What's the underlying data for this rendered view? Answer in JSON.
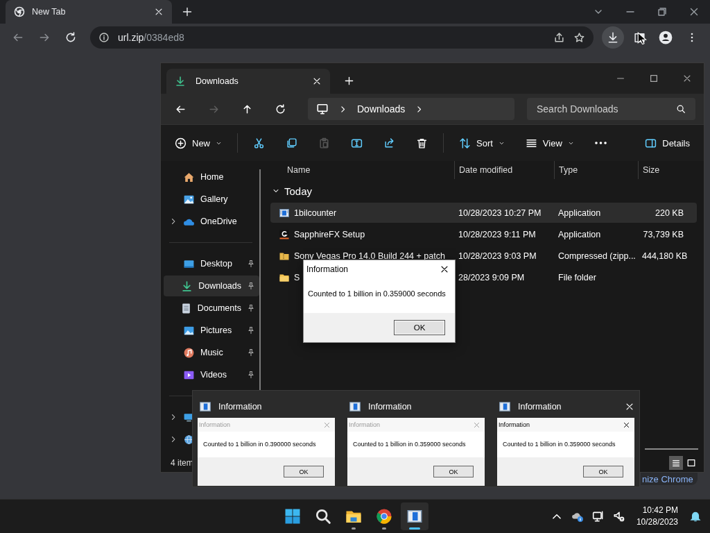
{
  "browser": {
    "tabs": [
      {
        "title": "New Tab",
        "selected": true
      }
    ],
    "address": {
      "host": "url.zip",
      "path": "/0384ed8"
    },
    "download_button": {
      "highlighted": true
    }
  },
  "explorer": {
    "tab_title": "Downloads",
    "breadcrumb": [
      "Downloads"
    ],
    "search": {
      "placeholder": "Search Downloads"
    },
    "nav": [
      {
        "kind": "back",
        "disabled": false
      },
      {
        "kind": "forward",
        "disabled": true
      },
      {
        "kind": "up",
        "disabled": false
      },
      {
        "kind": "refresh",
        "disabled": false
      }
    ],
    "toolbar": [
      {
        "kind": "new",
        "label": "New",
        "disabled": false
      },
      {
        "kind": "cut",
        "disabled": false
      },
      {
        "kind": "copy",
        "disabled": false
      },
      {
        "kind": "paste",
        "disabled": true
      },
      {
        "kind": "rename",
        "disabled": false
      },
      {
        "kind": "share",
        "disabled": false
      },
      {
        "kind": "delete",
        "disabled": false
      },
      {
        "kind": "sort",
        "label": "Sort",
        "disabled": false
      },
      {
        "kind": "view",
        "label": "View",
        "disabled": false
      },
      {
        "kind": "more",
        "disabled": false
      },
      {
        "kind": "details",
        "label": "Details",
        "disabled": false
      }
    ],
    "sidebar": {
      "sections": [
        [
          {
            "kind": "home",
            "label": "Home",
            "selected": false,
            "pinned": false,
            "expandable": false
          },
          {
            "kind": "gallery",
            "label": "Gallery",
            "selected": false,
            "pinned": false,
            "expandable": false
          },
          {
            "kind": "cloud",
            "label": "OneDrive",
            "selected": false,
            "pinned": false,
            "expandable": true
          }
        ],
        [
          {
            "kind": "desktop",
            "label": "Desktop",
            "selected": false,
            "pinned": true,
            "expandable": false
          },
          {
            "kind": "download",
            "label": "Downloads",
            "selected": true,
            "pinned": true,
            "expandable": false
          },
          {
            "kind": "docs",
            "label": "Documents",
            "selected": false,
            "pinned": true,
            "expandable": false
          },
          {
            "kind": "pictures",
            "label": "Pictures",
            "selected": false,
            "pinned": true,
            "expandable": false
          },
          {
            "kind": "music",
            "label": "Music",
            "selected": false,
            "pinned": true,
            "expandable": false
          },
          {
            "kind": "videos",
            "label": "Videos",
            "selected": false,
            "pinned": true,
            "expandable": false
          }
        ],
        [
          {
            "kind": "pc",
            "selected": false,
            "pinned": false,
            "expandable": true
          },
          {
            "kind": "network",
            "selected": false,
            "pinned": false,
            "expandable": true
          }
        ]
      ]
    },
    "columns": [
      "Name",
      "Date modified",
      "Type",
      "Size"
    ],
    "groups": [
      {
        "label": "Today",
        "expanded": true,
        "rows": [
          {
            "kind": "app",
            "name": "1bilcounter",
            "date": "10/28/2023 10:27 PM",
            "type": "Application",
            "size": "220 KB",
            "selected": true
          },
          {
            "kind": "setup",
            "name": "SapphireFX Setup",
            "date": "10/28/2023 9:11 PM",
            "type": "Application",
            "size": "73,739 KB",
            "selected": false
          },
          {
            "kind": "zip",
            "name": "Sony Vegas Pro 14.0 Build 244 + patch",
            "date": "10/28/2023 9:03 PM",
            "type": "Compressed (zipp...",
            "size": "444,180 KB",
            "selected": false
          },
          {
            "kind": "folder",
            "name": "S",
            "date": "28/2023 9:09 PM",
            "type": "File folder",
            "selected": false
          }
        ]
      }
    ],
    "status": "4 item",
    "view_modes": [
      {
        "kind": "details",
        "selected": true
      },
      {
        "kind": "tiles",
        "selected": false
      }
    ]
  },
  "dialog": {
    "title": "Information",
    "message": "Counted to 1 billion in 0.359000 seconds",
    "button": "OK"
  },
  "previews": [
    {
      "title": "Information",
      "dialog_title": "Information",
      "message": "Counted to 1 billion in 0.390000 seconds",
      "button": "OK",
      "active": false,
      "closable": false
    },
    {
      "title": "Information",
      "dialog_title": "Information",
      "message": "Counted to 1 billion in 0.359000 seconds",
      "button": "OK",
      "active": false,
      "closable": false
    },
    {
      "title": "Information",
      "dialog_title": "Information",
      "message": "Counted to 1 billion in 0.359000 seconds",
      "button": "OK",
      "active": true,
      "closable": true
    }
  ],
  "chrome_button": "nize Chrome",
  "taskbar": {
    "apps": [
      {
        "kind": "start",
        "running": false,
        "active": false
      },
      {
        "kind": "search",
        "running": false,
        "active": false
      },
      {
        "kind": "explorer",
        "running": true,
        "active": false
      },
      {
        "kind": "chrome",
        "running": true,
        "active": false
      },
      {
        "kind": "app",
        "running": true,
        "active": true
      }
    ],
    "tray": [
      {
        "kind": "caret"
      },
      {
        "kind": "onedrive"
      },
      {
        "kind": "network"
      },
      {
        "kind": "volume"
      }
    ],
    "time": "10:42 PM",
    "date": "10/28/2023"
  }
}
